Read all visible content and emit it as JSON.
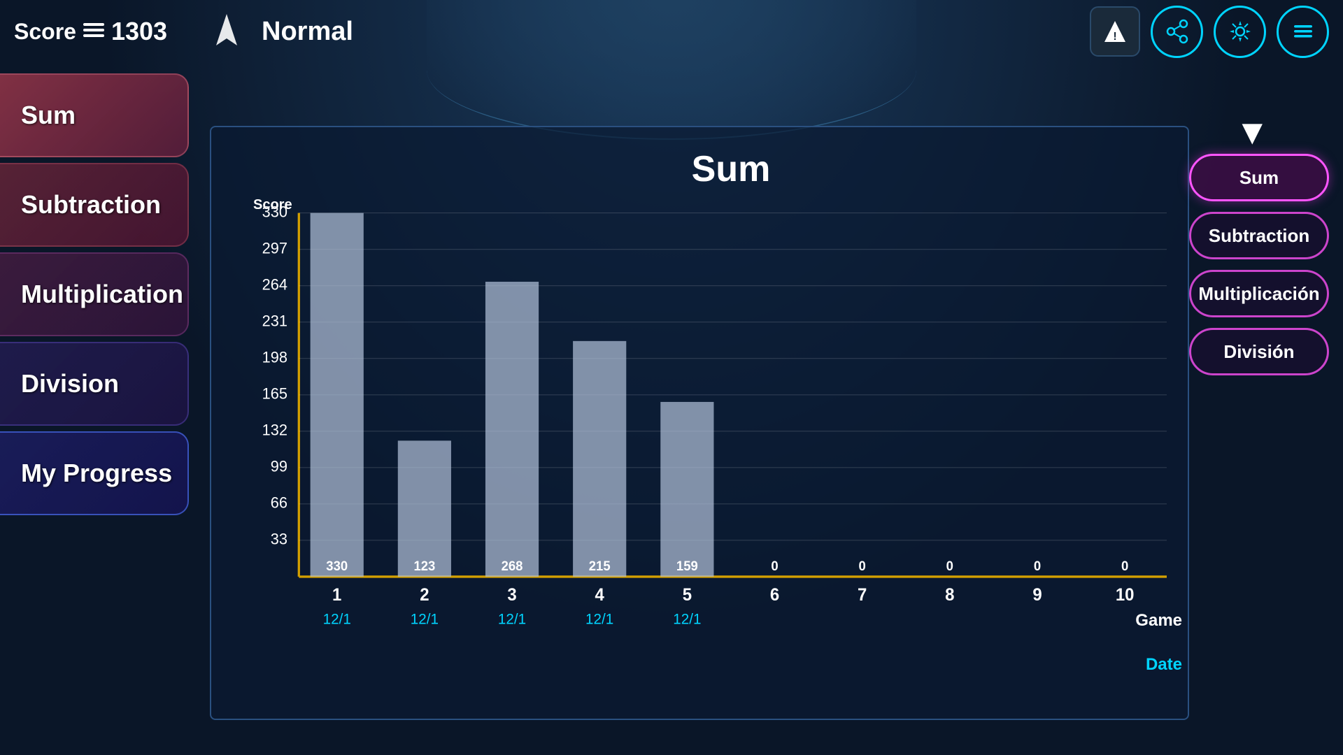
{
  "header": {
    "score_label": "Score",
    "score_value": "1303",
    "mode": "Normal",
    "spaceship_icon": "▲"
  },
  "sidebar": {
    "items": [
      {
        "id": "sum",
        "label": "Sum"
      },
      {
        "id": "subtraction",
        "label": "Subtraction"
      },
      {
        "id": "multiplication",
        "label": "Multiplication"
      },
      {
        "id": "division",
        "label": "Division"
      },
      {
        "id": "my-progress",
        "label": "My Progress"
      }
    ]
  },
  "chart": {
    "title": "Sum",
    "y_axis_label": "Score",
    "y_ticks": [
      "330",
      "297",
      "264",
      "231",
      "198",
      "165",
      "132",
      "99",
      "66",
      "33"
    ],
    "bars": [
      {
        "game": "1",
        "date": "12/1",
        "value": 330,
        "label": "330"
      },
      {
        "game": "2",
        "date": "12/1",
        "value": 123,
        "label": "123"
      },
      {
        "game": "3",
        "date": "12/1",
        "value": 268,
        "label": "268"
      },
      {
        "game": "4",
        "date": "12/1",
        "value": 215,
        "label": "215"
      },
      {
        "game": "5",
        "date": "12/1",
        "value": 159,
        "label": "159"
      },
      {
        "game": "6",
        "date": "",
        "value": 0,
        "label": "0"
      },
      {
        "game": "7",
        "date": "",
        "value": 0,
        "label": "0"
      },
      {
        "game": "8",
        "date": "",
        "value": 0,
        "label": "0"
      },
      {
        "game": "9",
        "date": "",
        "value": 0,
        "label": "0"
      },
      {
        "game": "10",
        "date": "",
        "value": 0,
        "label": "0"
      }
    ],
    "x_game_label": "Game",
    "x_date_label": "Date"
  },
  "right_panel": {
    "buttons": [
      {
        "id": "sum",
        "label": "Sum",
        "active": true
      },
      {
        "id": "subtraction",
        "label": "Subtraction",
        "active": false
      },
      {
        "id": "multiplicacion",
        "label": "Multiplicación",
        "active": false
      },
      {
        "id": "division",
        "label": "División",
        "active": false
      }
    ]
  },
  "icons": {
    "arrow_down": "▼",
    "share": "⤡",
    "settings": "⚙",
    "menu": "≡",
    "alert": "▲"
  }
}
